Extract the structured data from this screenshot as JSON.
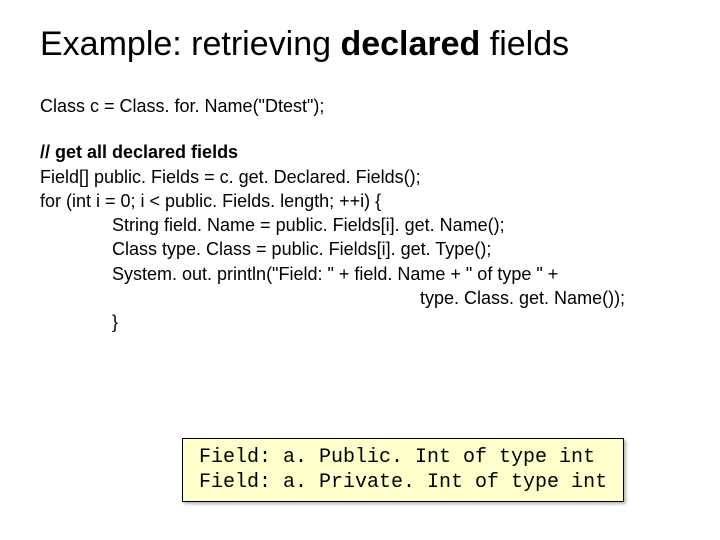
{
  "title": {
    "pre": "Example: retrieving ",
    "bold": "declared",
    "post": " fields"
  },
  "code": {
    "l1": "Class c = Class. for. Name(\"Dtest\");",
    "comment": "// get all declared fields",
    "l2": "Field[] public. Fields = c. get. Declared. Fields();",
    "l3": "for (int i = 0; i < public. Fields. length; ++i) {",
    "l4": "String field. Name = public. Fields[i]. get. Name();",
    "l5": "Class type. Class = public. Fields[i]. get. Type();",
    "l6": "System. out. println(\"Field: \" + field. Name + \" of type \" +",
    "l7": "type. Class. get. Name());",
    "l8": "}"
  },
  "output": {
    "line1": "Field: a. Public. Int of type int",
    "line2": "Field: a. Private. Int of type int"
  }
}
